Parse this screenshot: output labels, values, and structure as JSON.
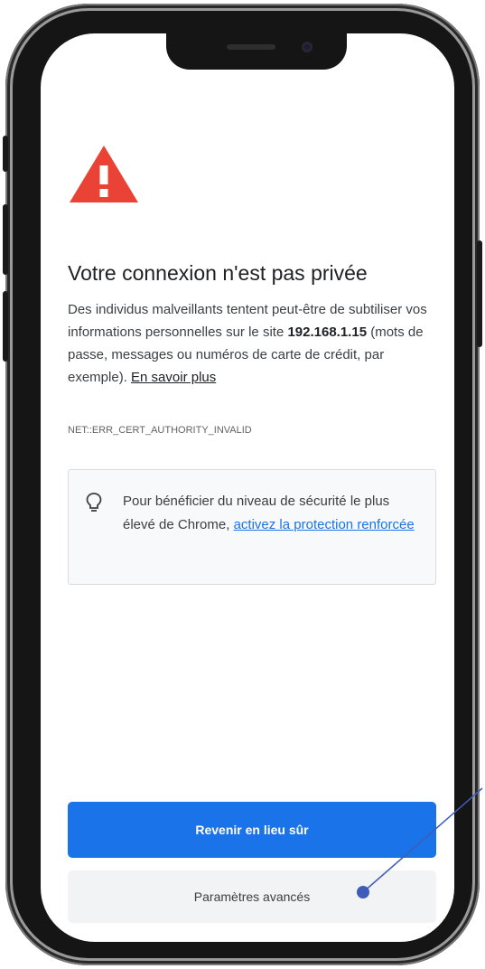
{
  "page": {
    "title": "Votre connexion n'est pas privée",
    "description": {
      "text_before": "Des individus malveillants tentent peut-être de subtiliser vos informations personnelles sur le site ",
      "host": "192.168.1.15",
      "text_after": " (mots de passe, messages ou numéros de carte de crédit, par exemple). ",
      "learn_more": "En savoir plus"
    },
    "error_code": "NET::ERR_CERT_AUTHORITY_INVALID",
    "tip": {
      "text": "Pour bénéficier du niveau de sécurité le plus élevé de Chrome, ",
      "link": "activez la protection renforcée"
    },
    "buttons": {
      "back_to_safety": "Revenir en lieu sûr",
      "advanced": "Paramètres avancés"
    }
  },
  "colors": {
    "warning_red": "#EA4335",
    "primary_blue": "#1A73E8",
    "callout_blue": "#3F5DB8"
  },
  "icons": {
    "warning": "warning-triangle-icon",
    "tip": "lightbulb-icon"
  }
}
